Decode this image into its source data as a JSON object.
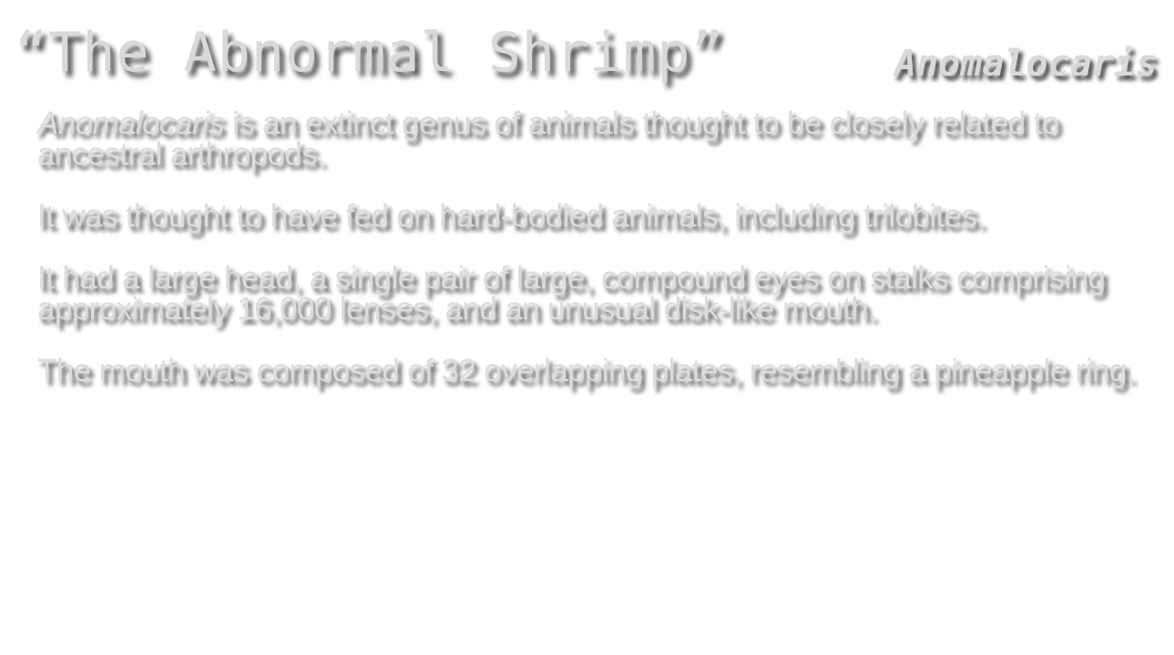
{
  "slide": {
    "title": "“The Abnormal Shrimp”",
    "genus": "Anomalocaris",
    "paragraphs": [
      {
        "lead_italic": "Anomalocaris",
        "text": " is an extinct genus of animals thought to be closely related to ancestral arthropods."
      },
      {
        "text": "It was thought to have fed on hard-bodied animals, including trilobites."
      },
      {
        "text": "It had a large head, a single pair of large, compound eyes on stalks comprising approximately 16,000 lenses, and an unusual disk-like mouth."
      },
      {
        "text": "The mouth was composed of 32 overlapping plates, resembling a pineapple ring."
      }
    ]
  }
}
